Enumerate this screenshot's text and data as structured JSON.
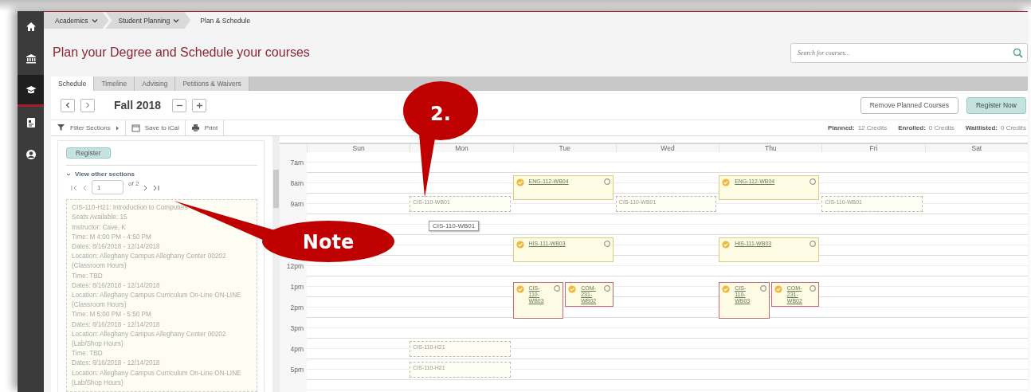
{
  "sidebar": {
    "items": [
      {
        "kind": "home",
        "selected": false
      },
      {
        "kind": "bank",
        "selected": false
      },
      {
        "kind": "cap",
        "selected": true
      },
      {
        "kind": "document",
        "selected": false
      },
      {
        "kind": "user",
        "selected": false
      }
    ]
  },
  "breadcrumb": [
    {
      "label": "Academics",
      "dropdown": true
    },
    {
      "label": "Student Planning",
      "dropdown": true
    },
    {
      "label": "Plan & Schedule",
      "dropdown": false
    }
  ],
  "title": "Plan your Degree and Schedule your courses",
  "search": {
    "placeholder": "Search for courses..."
  },
  "tabs": [
    {
      "label": "Schedule",
      "selected": true
    },
    {
      "label": "Timeline",
      "selected": false
    },
    {
      "label": "Advising",
      "selected": false
    },
    {
      "label": "Petitions & Waivers",
      "selected": false
    }
  ],
  "term": "Fall 2018",
  "buttons": [
    {
      "label": "Remove Planned Courses",
      "kind": "plain"
    },
    {
      "label": "Register Now",
      "kind": "primary"
    }
  ],
  "toolbar": [
    {
      "label": "Filter Sections",
      "kind": "filter"
    },
    {
      "label": "Save to iCal",
      "kind": "calendar"
    },
    {
      "label": "Print",
      "kind": "print"
    }
  ],
  "credits": [
    {
      "label": "Planned:",
      "value": "12 Credits"
    },
    {
      "label": "Enrolled:",
      "value": "0 Credits"
    },
    {
      "label": "Waitlisted:",
      "value": "0 Credits"
    }
  ],
  "section_panel": {
    "register_button": "Register",
    "other_sections": {
      "label": "View other sections",
      "expanded": true
    },
    "pager": {
      "page": "1",
      "total": "of 2"
    },
    "details": [
      "CIS-110-H21: Introduction to Computers",
      "Seats Available: 15",
      "Instructor: Cave, K",
      "Time: M 4:00 PM - 4:50 PM",
      "Dates: 8/16/2018 - 12/14/2018",
      "Location: Alleghany Campus Alleghany Center 00202 (Classroom Hours)",
      "Time: TBD",
      "Dates: 8/16/2018 - 12/14/2018",
      "Location: Alleghany Campus Curriculum On-Line ON-LINE (Classroom Hours)",
      "Time: M 5:00 PM - 5:50 PM",
      "Dates: 8/16/2018 - 12/14/2018",
      "Location: Alleghany Campus Alleghany Center 00202 (Lab/Shop Hours)",
      "Time: TBD",
      "Dates: 8/16/2018 - 12/14/2018",
      "Location: Alleghany Campus Curriculum On-Line ON-LINE (Lab/Shop Hours)"
    ]
  },
  "calendar": {
    "days": [
      {
        "label": "Sun"
      },
      {
        "label": "Mon"
      },
      {
        "label": "Tue"
      },
      {
        "label": "Wed"
      },
      {
        "label": "Thu"
      },
      {
        "label": "Fri"
      },
      {
        "label": "Sat"
      }
    ],
    "hours": [
      {
        "kind": "labeled",
        "label": "7am"
      },
      {
        "kind": "labeled",
        "label": "8am",
        "cells": [
          {},
          {},
          {
            "events": [
              {
                "code": "ENG-112-WB04",
                "kind": "planned",
                "conflict": false
              }
            ]
          },
          {},
          {
            "events": [
              {
                "code": "ENG-112-WB04",
                "kind": "planned",
                "conflict": false
              }
            ]
          },
          {},
          {}
        ]
      },
      {
        "kind": "labeled",
        "label": "9am",
        "cells": [
          {},
          {
            "events": [
              {
                "code": "CIS-110-WB01",
                "kind": "preview"
              }
            ]
          },
          {},
          {
            "events": [
              {
                "code": "CIS-110-WB01",
                "kind": "preview"
              }
            ]
          },
          {},
          {
            "events": [
              {
                "code": "CIS-110-WB01",
                "kind": "preview"
              }
            ]
          },
          {}
        ]
      },
      {
        "kind": "blank"
      },
      {
        "kind": "blank",
        "cells": [
          {},
          {},
          {
            "events": [
              {
                "code": "HIS-111-WB03",
                "kind": "planned",
                "conflict": false
              }
            ]
          },
          {},
          {
            "events": [
              {
                "code": "HIS-111-WB03",
                "kind": "planned",
                "conflict": false
              }
            ]
          },
          {},
          {}
        ]
      },
      {
        "kind": "labeled",
        "label": "12pm"
      },
      {
        "kind": "labeled",
        "label": "1pm",
        "cells": [
          {},
          {},
          {
            "events": [
              {
                "code": "CIS-110-WB03",
                "kind": "conflict_left",
                "conflict": true
              },
              {
                "code": "COM-231-WB02",
                "kind": "conflict_right",
                "conflict": true
              }
            ]
          },
          {},
          {
            "events": [
              {
                "code": "CIS-110-WB03",
                "kind": "conflict_left",
                "conflict": true
              },
              {
                "code": "COM-231-WB02",
                "kind": "conflict_right",
                "conflict": true
              }
            ]
          },
          {},
          {}
        ]
      },
      {
        "kind": "labeled",
        "label": "2pm"
      },
      {
        "kind": "labeled",
        "label": "3pm"
      },
      {
        "kind": "labeled",
        "label": "4pm",
        "cells": [
          {},
          {
            "events": [
              {
                "code": "CIS-110-H21",
                "kind": "preview"
              }
            ]
          },
          {},
          {},
          {},
          {},
          {}
        ]
      },
      {
        "kind": "labeled",
        "label": "5pm",
        "cells": [
          {},
          {
            "events": [
              {
                "code": "CIS-110-H21",
                "kind": "preview"
              }
            ]
          },
          {},
          {},
          {},
          {},
          {}
        ]
      },
      {
        "kind": "blank"
      }
    ],
    "tooltip": "CIS-110-WB01"
  },
  "annotations": [
    {
      "text": "2.",
      "kind": "circle"
    },
    {
      "text": "Note",
      "kind": "ellipse"
    }
  ]
}
